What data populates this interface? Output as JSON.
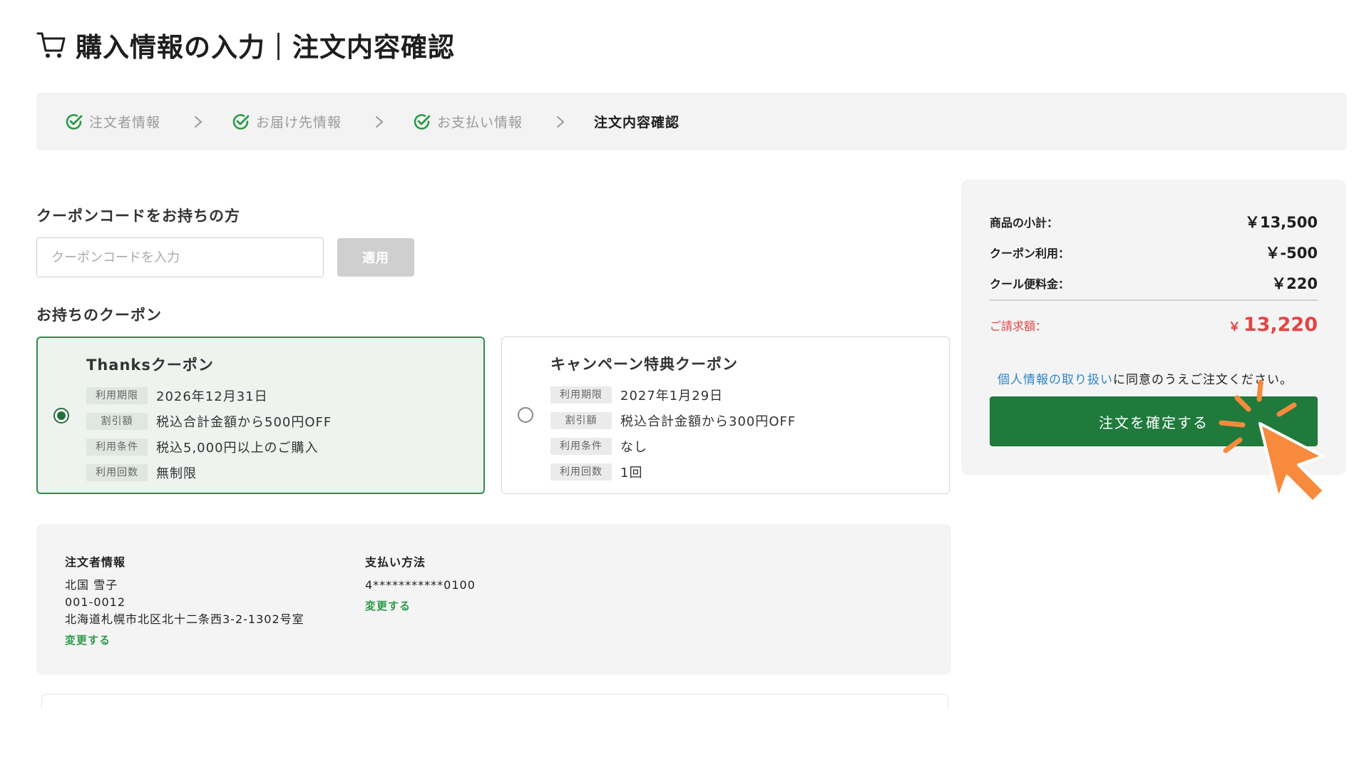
{
  "header": {
    "title": "購入情報の入力｜注文内容確認",
    "cart_icon": "cart-icon"
  },
  "stepper": {
    "steps": [
      {
        "label": "注文者情報",
        "status": "done"
      },
      {
        "label": "お届け先情報",
        "status": "done"
      },
      {
        "label": "お支払い情報",
        "status": "done"
      },
      {
        "label": "注文内容確認",
        "status": "current"
      }
    ]
  },
  "coupon_code": {
    "heading": "クーポンコードをお持ちの方",
    "placeholder": "クーポンコードを入力",
    "value": "",
    "apply_label": "適用"
  },
  "owned_coupons": {
    "heading": "お持ちのクーポン",
    "cards": [
      {
        "name": "Thanksクーポン",
        "selected": true,
        "rows": [
          {
            "tag": "利用期限",
            "value": "2026年12月31日"
          },
          {
            "tag": "割引額",
            "value": "税込合計金額から500円OFF"
          },
          {
            "tag": "利用条件",
            "value": "税込5,000円以上のご購入"
          },
          {
            "tag": "利用回数",
            "value": "無制限"
          }
        ]
      },
      {
        "name": "キャンペーン特典クーポン",
        "selected": false,
        "rows": [
          {
            "tag": "利用期限",
            "value": "2027年1月29日"
          },
          {
            "tag": "割引額",
            "value": "税込合計金額から300円OFF"
          },
          {
            "tag": "利用条件",
            "value": "なし"
          },
          {
            "tag": "利用回数",
            "value": "1回"
          }
        ]
      }
    ]
  },
  "orderer": {
    "heading": "注文者情報",
    "name": "北国 雪子",
    "postal": "001-0012",
    "address": "北海道札幌市北区北十二条西3-2-1302号室",
    "change_label": "変更する"
  },
  "payment": {
    "heading": "支払い方法",
    "card": "4***********0100",
    "change_label": "変更する"
  },
  "summary": {
    "subtotal_label": "商品の小計：",
    "subtotal_value": "￥13,500",
    "coupon_label": "クーポン利用：",
    "coupon_value": "￥-500",
    "cool_fee_label": "クール便料金：",
    "cool_fee_value": "￥220",
    "total_label": "ご請求額：",
    "total_currency": "￥",
    "total_value": "13,220",
    "agree_link": "個人情報の取り扱い",
    "agree_rest": "に同意のうえご注文ください。",
    "confirm_label": "注文を確定する"
  },
  "colors": {
    "brand_green": "#1f7a3b",
    "check_green": "#2b9a48",
    "total_red": "#e34545",
    "link_blue": "#2c86c9",
    "cursor_orange": "#f78a3d"
  }
}
